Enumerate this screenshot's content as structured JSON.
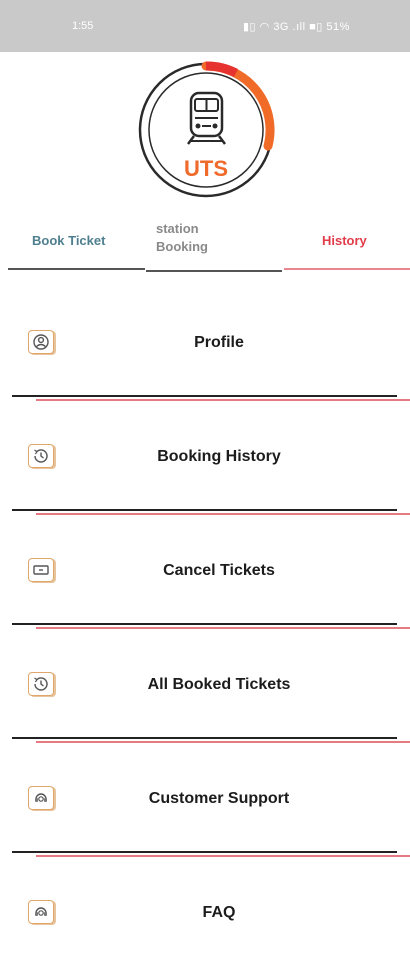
{
  "status_bar": {
    "time": "1:55",
    "icons": "▮▯ ◠ 3G .ıll ■▯ 51%"
  },
  "logo": {
    "text": "UTS",
    "ring_color": "#f06a28",
    "text_color": "#ef6a2b"
  },
  "tabs": [
    {
      "label": "Book Ticket"
    },
    {
      "label": "station Booking"
    },
    {
      "label": "History"
    }
  ],
  "menu": [
    {
      "label": "Profile",
      "icon": "profile-icon"
    },
    {
      "label": "Booking History",
      "icon": "clock-icon"
    },
    {
      "label": "Cancel Tickets",
      "icon": "ticket-icon"
    },
    {
      "label": "All Booked Tickets",
      "icon": "clock-icon"
    },
    {
      "label": "Customer Support",
      "icon": "support-icon"
    },
    {
      "label": "FAQ",
      "icon": "faq-icon"
    }
  ],
  "colors": {
    "accent": "#e23c4a",
    "icon_border": "#e0a76b",
    "tab_active": "#4f7f8f"
  }
}
